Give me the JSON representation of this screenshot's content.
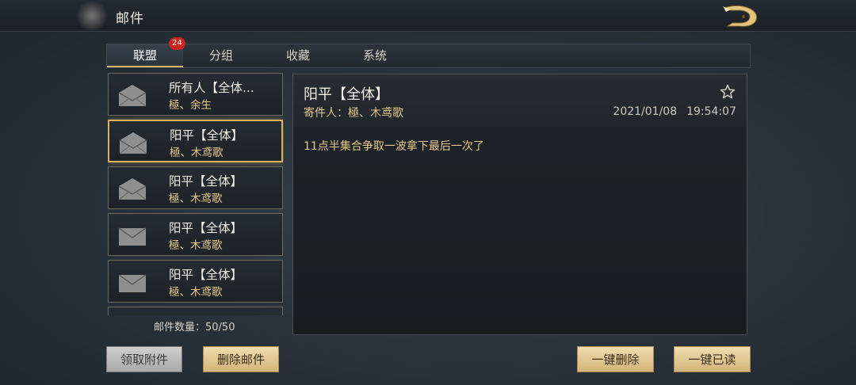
{
  "header": {
    "title": "邮件",
    "back_icon": "dragon-back-icon"
  },
  "tabs": [
    {
      "label": "联盟",
      "active": true,
      "badge": "24"
    },
    {
      "label": "分组",
      "active": false
    },
    {
      "label": "收藏",
      "active": false
    },
    {
      "label": "系统",
      "active": false
    }
  ],
  "mail_list": {
    "items": [
      {
        "title": "所有人【全体...",
        "sender": "極、余生",
        "icon": "open-envelope-icon",
        "selected": false
      },
      {
        "title": "阳平【全体】",
        "sender": "極、木鸢歌",
        "icon": "open-envelope-icon",
        "selected": true
      },
      {
        "title": "阳平【全体】",
        "sender": "極、木鸢歌",
        "icon": "open-envelope-icon",
        "selected": false
      },
      {
        "title": "阳平【全体】",
        "sender": "極、木鸢歌",
        "icon": "closed-envelope-icon",
        "selected": false
      },
      {
        "title": "阳平【全体】",
        "sender": "極、木鸢歌",
        "icon": "closed-envelope-icon",
        "selected": false
      }
    ],
    "count_text": "邮件数量：50/50"
  },
  "detail": {
    "title": "阳平【全体】",
    "sender_label": "寄件人：",
    "sender": "極、木鸢歌",
    "date": "2021/01/08",
    "time": "19:54:07",
    "body": "11点半集合争取一波拿下最后一次了",
    "star_icon": "star-outline-icon"
  },
  "buttons": {
    "claim": "领取附件",
    "delete": "删除邮件",
    "delete_all": "一键删除",
    "read_all": "一键已读"
  },
  "colors": {
    "accent_gold": "#d9b15c",
    "badge_red": "#c9241e",
    "sender_gold": "#e7c98a"
  }
}
